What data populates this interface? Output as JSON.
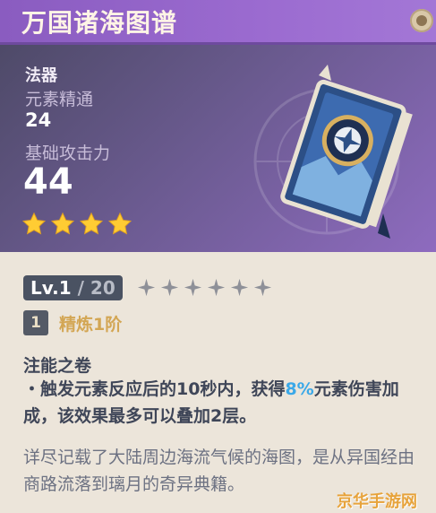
{
  "window": {
    "title": "万国诸海图谱"
  },
  "stats": {
    "type_label": "法器",
    "stat1_name": "元素精通",
    "stat1_value": "24",
    "stat2_name": "基础攻击力",
    "stat2_value": "44",
    "rarity_stars": 4,
    "star_color": "#ffcc33"
  },
  "level": {
    "current": "Lv.1",
    "max": " / 20",
    "ascension_stars_empty": 6
  },
  "refinement": {
    "rank": "1",
    "label": "精炼1阶"
  },
  "skill": {
    "name": "注能之卷",
    "desc_prefix": "・触发元素反应后的10秒内，获得",
    "desc_highlight": "8%",
    "desc_suffix": "元素伤害加成，该效果最多可以叠加2层。"
  },
  "lore": {
    "text": "详尽记载了大陆周边海流气候的海图，是从异国经由商路流落到璃月的奇异典籍。"
  },
  "watermark": {
    "text": "京华手游网"
  },
  "colors": {
    "header": "#9b6bd0",
    "highlight": "#3aa8e8",
    "refine": "#d3a654"
  }
}
